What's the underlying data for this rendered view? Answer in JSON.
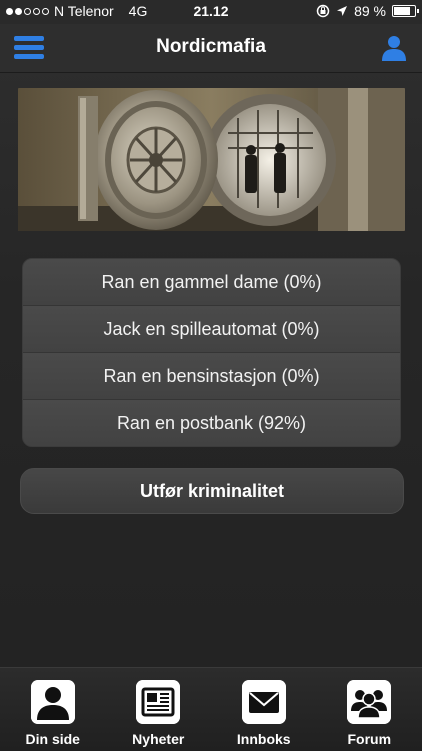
{
  "status": {
    "carrier": "N Telenor",
    "network": "4G",
    "time": "21.12",
    "battery": "89 %",
    "battery_level": 0.89
  },
  "nav": {
    "title": "Nordicmafia",
    "menu_icon": "hamburger-icon",
    "user_icon": "user-icon"
  },
  "options": [
    {
      "label": "Ran en gammel dame (0%)"
    },
    {
      "label": "Jack en spilleautomat (0%)"
    },
    {
      "label": "Ran en bensinstasjon (0%)"
    },
    {
      "label": "Ran en postbank (92%)"
    }
  ],
  "action": {
    "label": "Utfør kriminalitet"
  },
  "tabs": [
    {
      "label": "Din side",
      "icon": "person-icon"
    },
    {
      "label": "Nyheter",
      "icon": "newspaper-icon"
    },
    {
      "label": "Innboks",
      "icon": "envelope-icon"
    },
    {
      "label": "Forum",
      "icon": "group-icon"
    }
  ],
  "colors": {
    "accent": "#2f7fe4"
  }
}
